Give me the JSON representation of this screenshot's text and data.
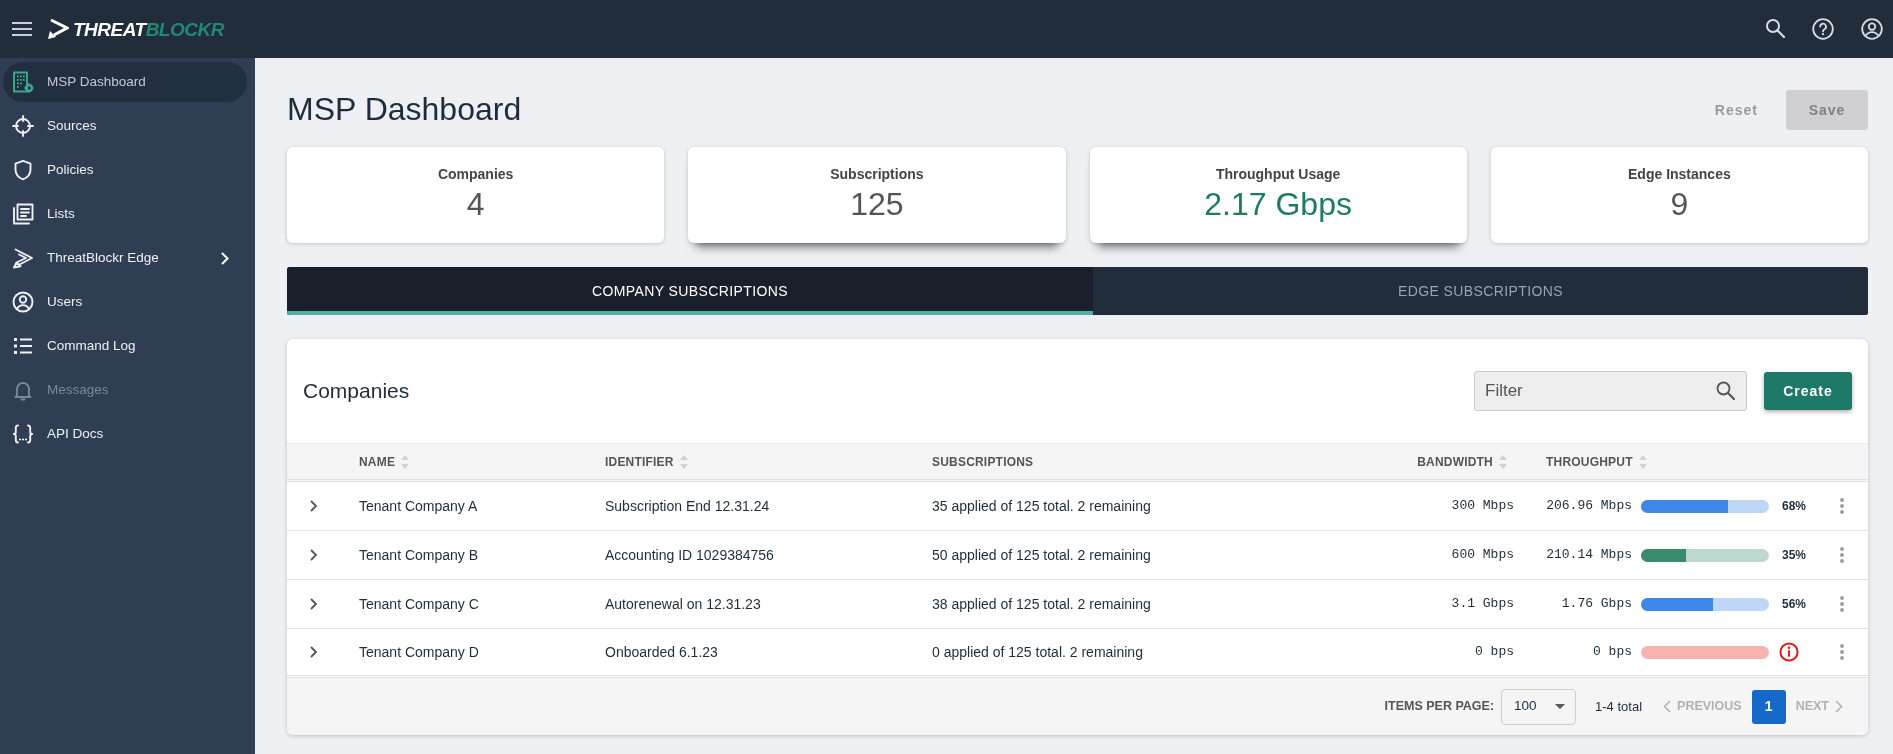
{
  "header": {
    "brand": [
      "THREAT",
      "BLOCKR"
    ]
  },
  "sidebar": {
    "items": [
      {
        "label": "MSP Dashboard",
        "selected": true,
        "disabled": false,
        "submenu": false
      },
      {
        "label": "Sources",
        "selected": false,
        "disabled": false,
        "submenu": false
      },
      {
        "label": "Policies",
        "selected": false,
        "disabled": false,
        "submenu": false
      },
      {
        "label": "Lists",
        "selected": false,
        "disabled": false,
        "submenu": false
      },
      {
        "label": "ThreatBlockr Edge",
        "selected": false,
        "disabled": false,
        "submenu": true
      },
      {
        "label": "Users",
        "selected": false,
        "disabled": false,
        "submenu": false
      },
      {
        "label": "Command Log",
        "selected": false,
        "disabled": false,
        "submenu": false
      },
      {
        "label": "Messages",
        "selected": false,
        "disabled": true,
        "submenu": false
      },
      {
        "label": "API Docs",
        "selected": false,
        "disabled": false,
        "submenu": false
      }
    ]
  },
  "page": {
    "title": "MSP Dashboard",
    "buttons": [
      {
        "label": "Reset",
        "kind": "text",
        "disabled": true
      },
      {
        "label": "Save",
        "kind": "filled",
        "disabled": true
      }
    ]
  },
  "stats": [
    {
      "label": "Companies",
      "value": "4",
      "color": "#555555",
      "raised": false
    },
    {
      "label": "Subscriptions",
      "value": "125",
      "color": "#555555",
      "raised": true
    },
    {
      "label": "Throughput Usage",
      "value": "2.17 Gbps",
      "color": "#1e7b64",
      "raised": true
    },
    {
      "label": "Edge Instances",
      "value": "9",
      "color": "#555555",
      "raised": false
    }
  ],
  "tabs": [
    {
      "label": "COMPANY SUBSCRIPTIONS",
      "selected": true
    },
    {
      "label": "EDGE SUBSCRIPTIONS",
      "selected": false
    }
  ],
  "companies": {
    "title": "Companies",
    "filter": {
      "placeholder": "Filter"
    },
    "create_button": "Create",
    "table": {
      "columns": [
        {
          "label": "NAME",
          "sortable": true
        },
        {
          "label": "IDENTIFIER",
          "sortable": true
        },
        {
          "label": "SUBSCRIPTIONS",
          "sortable": false
        },
        {
          "label": "BANDWIDTH",
          "sortable": true
        },
        {
          "label": "THROUGHPUT",
          "sortable": true
        }
      ],
      "rows": [
        {
          "expanded": false,
          "name": "Tenant Company A",
          "identifier": "Subscription End 12.31.24",
          "subscriptions": "35 applied of 125 total. 2 remaining",
          "bandwidth": "300 Mbps",
          "throughput": "206.96 Mbps",
          "level": 0.68,
          "percent": "68%",
          "color": "#3d87e8",
          "alert": false
        },
        {
          "expanded": false,
          "name": "Tenant Company B",
          "identifier": "Accounting ID 1029384756",
          "subscriptions": "50 applied of 125 total. 2 remaining",
          "bandwidth": "600 Mbps",
          "throughput": "210.14 Mbps",
          "level": 0.35,
          "percent": "35%",
          "color": "#3a8a6e",
          "alert": false
        },
        {
          "expanded": false,
          "name": "Tenant Company C",
          "identifier": "Autorenewal on 12.31.23",
          "subscriptions": "38 applied of 125 total. 2 remaining",
          "bandwidth": "3.1 Gbps",
          "throughput": "1.76 Gbps",
          "level": 0.56,
          "percent": "56%",
          "color": "#3d87e8",
          "alert": false
        },
        {
          "expanded": false,
          "name": "Tenant Company D",
          "identifier": "Onboarded 6.1.23",
          "subscriptions": "0 applied of 125 total. 2 remaining",
          "bandwidth": "0 bps",
          "throughput": "0 bps",
          "color": "#e31b12",
          "alert": true
        }
      ]
    },
    "footer": {
      "items_per_page_label": "ITEMS PER PAGE:",
      "items_per_page": "100",
      "total": "1-4 total",
      "previous": {
        "label": "PREVIOUS",
        "disabled": true
      },
      "pages": [
        {
          "label": "1",
          "selected": true
        }
      ],
      "next": {
        "label": "NEXT",
        "disabled": true
      }
    }
  }
}
